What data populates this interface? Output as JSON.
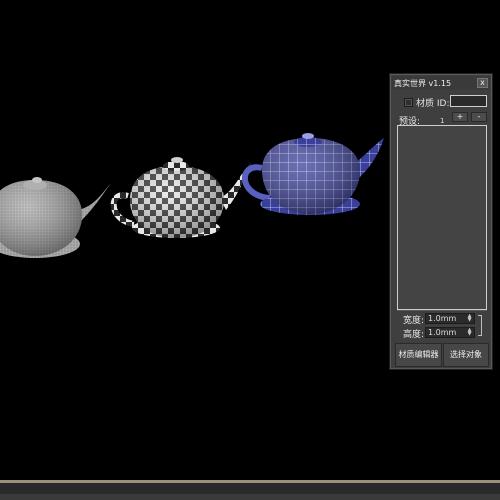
{
  "panel": {
    "title": "真实世界 v1.15",
    "close_glyph": "x",
    "material_id_label": "材质 ID:",
    "material_id_value": "",
    "preset_label": "预设:",
    "preset_marker": "1",
    "add_label": "+",
    "remove_label": "-",
    "width_label": "宽度:",
    "width_value": "1.0mm",
    "height_label": "高度:",
    "height_value": "1.0mm",
    "spin_up": "▲",
    "spin_down": "▼",
    "material_editor_label": "材质编辑器",
    "select_object_label": "选择对象"
  },
  "viewport": {
    "background": "#000000",
    "objects": [
      "teapot-gray-wireframe",
      "teapot-checker",
      "teapot-blue-grid"
    ]
  }
}
